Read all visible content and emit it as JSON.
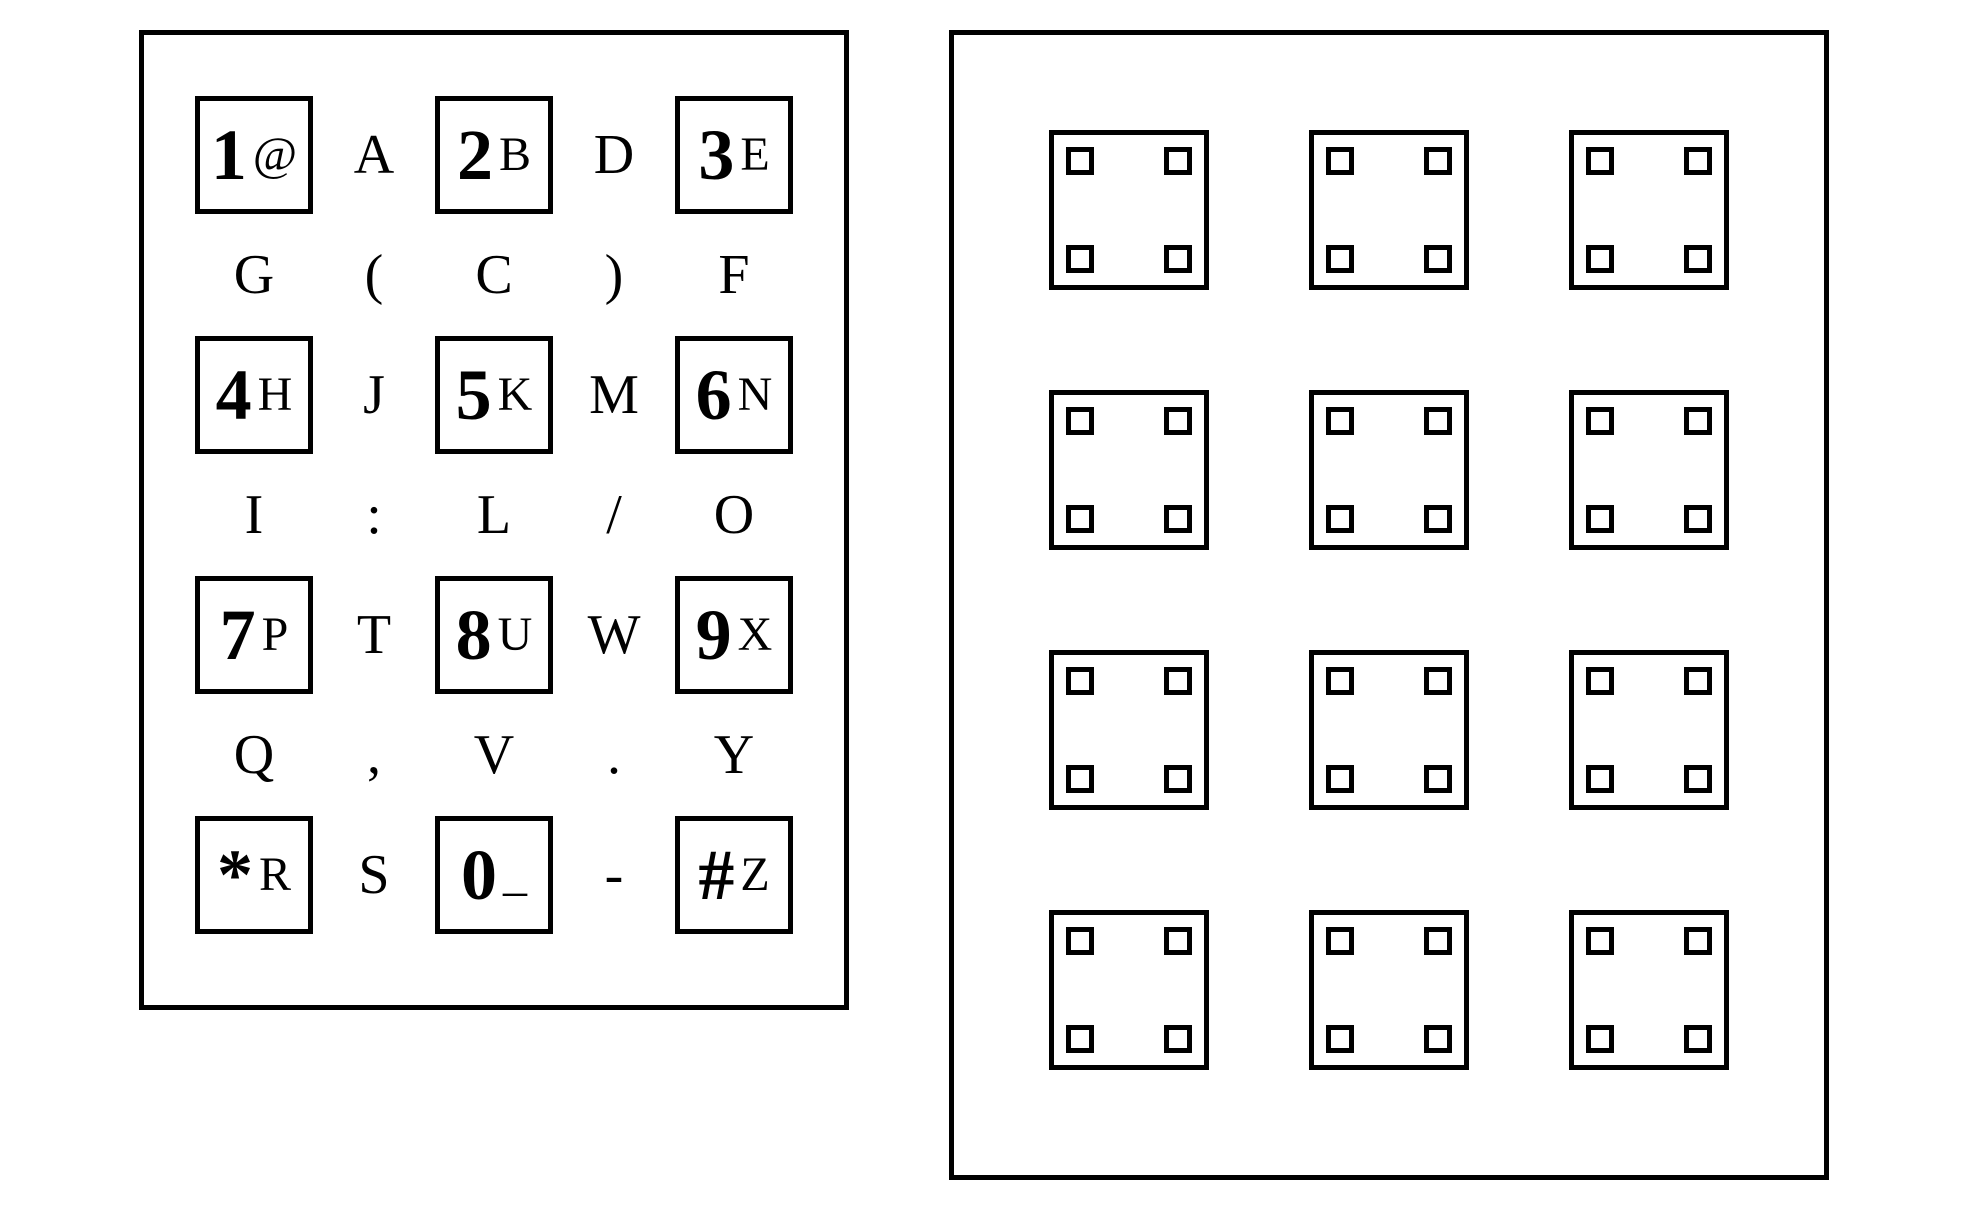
{
  "left_keypad": {
    "keys": [
      {
        "main": "1",
        "sub": "@"
      },
      {
        "main": "2",
        "sub": "B"
      },
      {
        "main": "3",
        "sub": "E"
      },
      {
        "main": "4",
        "sub": "H"
      },
      {
        "main": "5",
        "sub": "K"
      },
      {
        "main": "6",
        "sub": "N"
      },
      {
        "main": "7",
        "sub": "P"
      },
      {
        "main": "8",
        "sub": "U"
      },
      {
        "main": "9",
        "sub": "X"
      },
      {
        "main": "*",
        "sub": "R"
      },
      {
        "main": "0",
        "sub": "_"
      },
      {
        "main": "#",
        "sub": "Z"
      }
    ],
    "between_keys_row1": [
      "A",
      "D"
    ],
    "between_keys_row2": [
      "J",
      "M"
    ],
    "between_keys_row3": [
      "T",
      "W"
    ],
    "between_keys_row4": [
      "S",
      "-"
    ],
    "below_row1": [
      "G",
      "(",
      "C",
      ")",
      "F"
    ],
    "below_row2": [
      "I",
      ":",
      "L",
      "/",
      "O"
    ],
    "below_row3": [
      "Q",
      ",",
      "V",
      ".",
      "Y"
    ]
  },
  "right_keypad": {
    "rows": 4,
    "cols": 3,
    "switch_contacts": 4
  }
}
